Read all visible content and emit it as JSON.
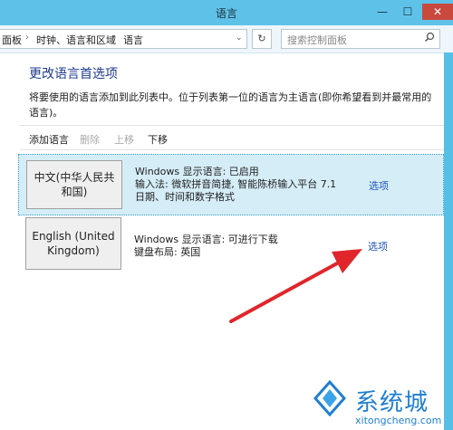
{
  "window": {
    "title": "语言",
    "close_symbol": "✕",
    "minimize_symbol": "—",
    "maximize_symbol": "☐"
  },
  "address": {
    "crumbs": [
      "面板",
      "时钟、语言和区域",
      "语言"
    ],
    "separator": "›",
    "dropdown_symbol": "⌄",
    "refresh_symbol": "↻"
  },
  "search": {
    "placeholder": "搜索控制面板",
    "icon": "search-icon"
  },
  "main": {
    "heading": "更改语言首选项",
    "description": "将要使用的语言添加到此列表中。位于列表第一位的语言为主语言(即你希望看到并最常用的语言)。"
  },
  "toolbar": {
    "add": "添加语言",
    "remove": "删除",
    "up": "上移",
    "down": "下移"
  },
  "languages": [
    {
      "name": "中文(中华人民共和国)",
      "lines": [
        "Windows 显示语言: 已启用",
        "输入法: 微软拼音简捷, 智能陈桥输入平台 7.1",
        "日期、时间和数字格式"
      ],
      "options": "选项"
    },
    {
      "name": "English (United Kingdom)",
      "lines": [
        "Windows 显示语言: 可进行下载",
        "键盘布局: 英国"
      ],
      "options": "选项"
    }
  ],
  "watermark": {
    "brand": "系统城",
    "url": "xitongcheng.com"
  },
  "colors": {
    "titlebar": "#5ec2e8",
    "heading": "#1e3a8c",
    "link": "#1f56b8",
    "arrow": "#e0262b",
    "selection": "#d5edf7"
  }
}
